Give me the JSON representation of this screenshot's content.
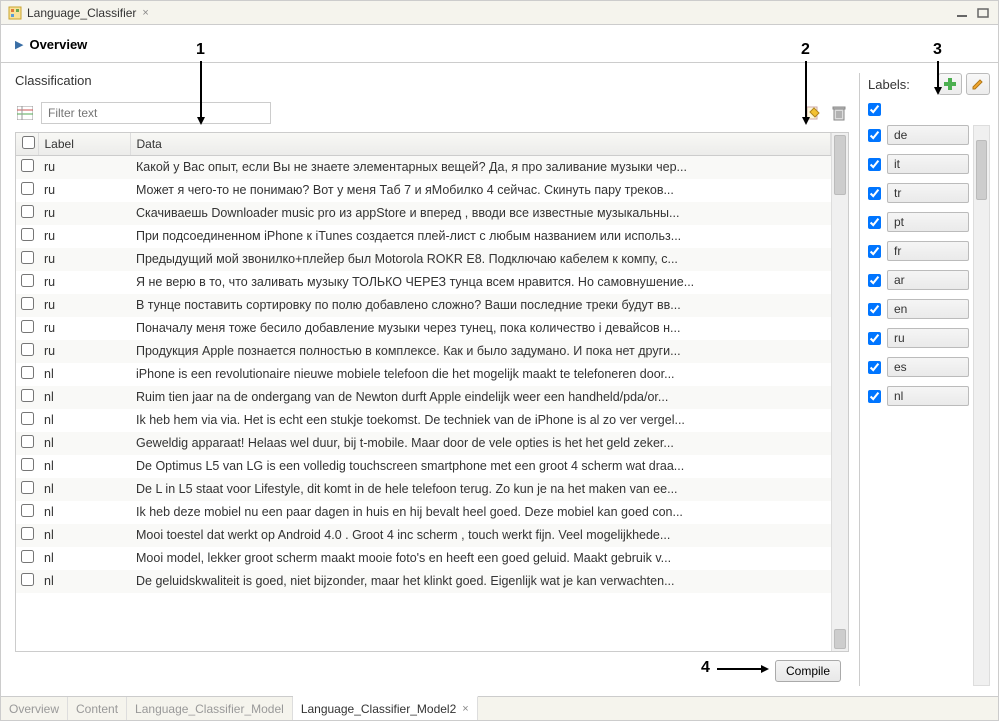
{
  "window": {
    "title": "Language_Classifier"
  },
  "overview": {
    "title": "Overview"
  },
  "classification": {
    "title": "Classification",
    "filter_placeholder": "Filter text",
    "columns": {
      "label": "Label",
      "data": "Data"
    },
    "rows": [
      {
        "label": "ru",
        "data": "Какой у Вас опыт, если Вы не знаете элементарных вещей? Да, я про заливание музыки чер..."
      },
      {
        "label": "ru",
        "data": "Может я чего-то не понимаю? Вот у меня Таб 7 и яМобилко 4 сейчас. Скинуть пару треков..."
      },
      {
        "label": "ru",
        "data": "Скачиваешь Downloader music pro  из appStore  и вперед , вводи все известные музыкальны..."
      },
      {
        "label": "ru",
        "data": "При подсоединенном iPhone к iTunes создается плей-лист с любым названием или использ..."
      },
      {
        "label": "ru",
        "data": "Предыдущий мой звонилко+плейер был Motorola ROKR E8. Подключаю кабелем к компу, с..."
      },
      {
        "label": "ru",
        "data": "Я не верю в то, что заливать музыку ТОЛЬКО ЧЕРЕЗ тунца всем нравится. Но самовнушение..."
      },
      {
        "label": "ru",
        "data": "В тунце поставить сортировку по полю добавлено сложно? Ваши последние треки будут вв..."
      },
      {
        "label": "ru",
        "data": "Поначалу меня тоже бесило добавление музыки через тунец, пока количество i девайсов н..."
      },
      {
        "label": "ru",
        "data": "Продукция Apple познается полностью в комплексе. Как и было задумано. И пока нет други..."
      },
      {
        "label": "nl",
        "data": "iPhone is een revolutionaire nieuwe mobiele telefoon die het mogelijk maakt te telefoneren door..."
      },
      {
        "label": "nl",
        "data": "Ruim tien jaar na de ondergang van de Newton durft Apple eindelijk weer een handheld/pda/or..."
      },
      {
        "label": "nl",
        "data": "Ik heb hem via via. Het is echt een stukje toekomst. De techniek van de iPhone is al zo ver vergel..."
      },
      {
        "label": "nl",
        "data": "Geweldig apparaat! Helaas wel duur, bij t-mobile. Maar door de vele opties is het het geld zeker..."
      },
      {
        "label": "nl",
        "data": "De Optimus L5 van LG is een volledig touchscreen smartphone met een groot 4 scherm wat draa..."
      },
      {
        "label": "nl",
        "data": "De L in L5 staat voor Lifestyle, dit komt in de hele telefoon terug. Zo kun je na het maken van ee..."
      },
      {
        "label": "nl",
        "data": "Ik heb deze mobiel nu een paar dagen in huis en hij bevalt heel goed. Deze mobiel kan goed con..."
      },
      {
        "label": "nl",
        "data": "Mooi toestel dat werkt op Android 4.0 . Groot 4 inc scherm , touch werkt fijn. Veel mogelijkhede..."
      },
      {
        "label": "nl",
        "data": "Mooi model, lekker groot scherm maakt mooie foto's en heeft een goed geluid. Maakt gebruik v..."
      },
      {
        "label": "nl",
        "data": "De geluidskwaliteit is goed, niet bijzonder, maar het klinkt goed. Eigenlijk wat je kan verwachten..."
      }
    ],
    "compile_label": "Compile"
  },
  "labels_panel": {
    "title": "Labels:",
    "items": [
      {
        "code": "de",
        "checked": true
      },
      {
        "code": "it",
        "checked": true
      },
      {
        "code": "tr",
        "checked": true
      },
      {
        "code": "pt",
        "checked": true
      },
      {
        "code": "fr",
        "checked": true
      },
      {
        "code": "ar",
        "checked": true
      },
      {
        "code": "en",
        "checked": true
      },
      {
        "code": "ru",
        "checked": true
      },
      {
        "code": "es",
        "checked": true
      },
      {
        "code": "nl",
        "checked": true
      }
    ]
  },
  "bottom_tabs": {
    "items": [
      {
        "label": "Overview",
        "active": false
      },
      {
        "label": "Content",
        "active": false
      },
      {
        "label": "Language_Classifier_Model",
        "active": false
      },
      {
        "label": "Language_Classifier_Model2",
        "active": true
      }
    ]
  },
  "annotations": {
    "n1": "1",
    "n2": "2",
    "n3": "3",
    "n4": "4"
  }
}
